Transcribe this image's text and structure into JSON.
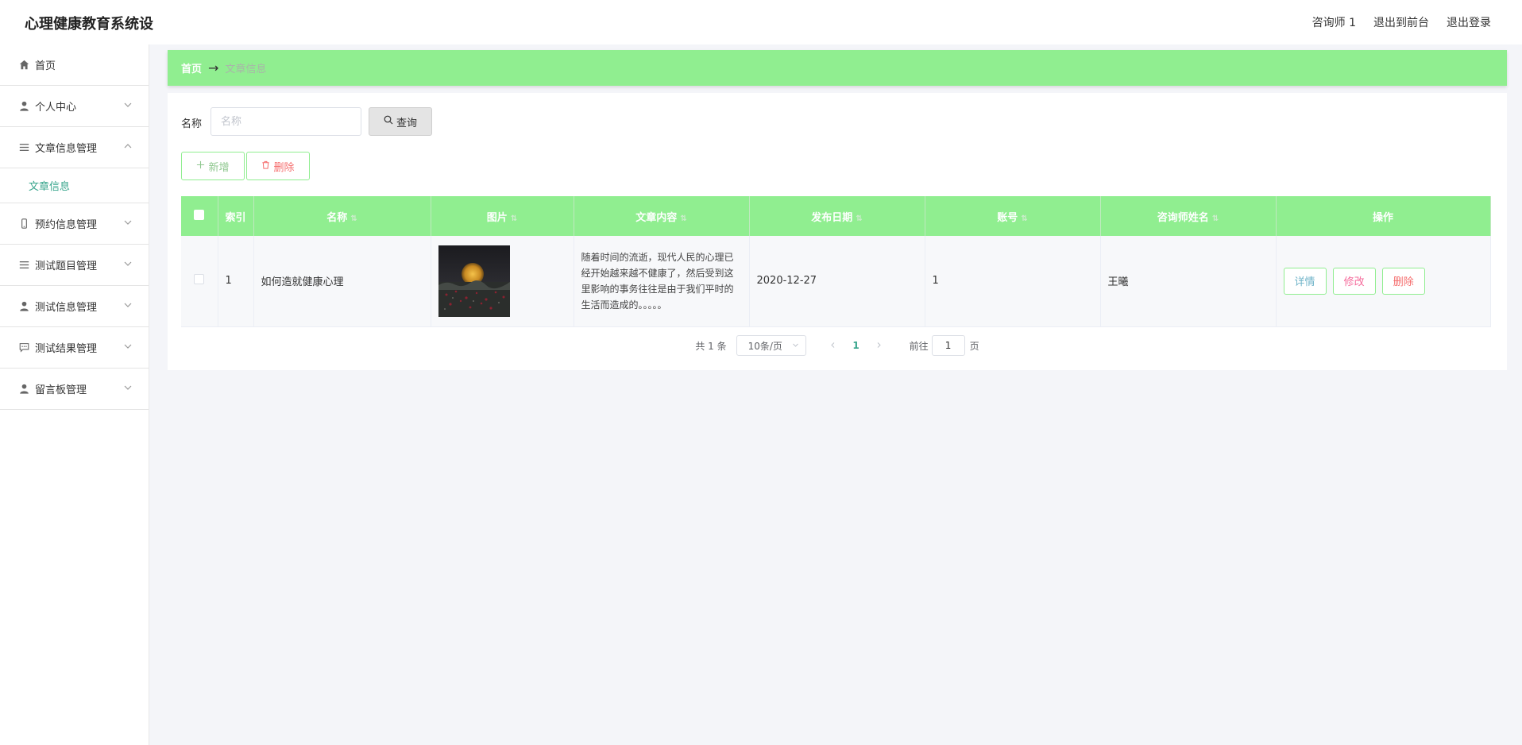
{
  "header": {
    "brand": "心理健康教育系统设",
    "user_label": "咨询师 1",
    "to_front": "退出到前台",
    "logout": "退出登录"
  },
  "sidebar": {
    "items": [
      {
        "label": "首页",
        "icon": "home-icon"
      },
      {
        "label": "个人中心",
        "icon": "user-icon"
      },
      {
        "label": "文章信息管理",
        "icon": "list-icon",
        "expanded": true,
        "sub": [
          {
            "label": "文章信息"
          }
        ]
      },
      {
        "label": "预约信息管理",
        "icon": "phone-icon"
      },
      {
        "label": "测试题目管理",
        "icon": "list-icon"
      },
      {
        "label": "测试信息管理",
        "icon": "user-icon"
      },
      {
        "label": "测试结果管理",
        "icon": "chat-icon"
      },
      {
        "label": "留言板管理",
        "icon": "user-icon"
      }
    ]
  },
  "breadcrumb": {
    "home": "首页",
    "arrow": "→",
    "current": "文章信息"
  },
  "search": {
    "label": "名称",
    "placeholder": "名称",
    "value": "",
    "button": "查询"
  },
  "actions": {
    "add": "新增",
    "delete": "删除"
  },
  "table": {
    "columns": [
      "索引",
      "名称",
      "图片",
      "文章内容",
      "发布日期",
      "账号",
      "咨询师姓名",
      "操作"
    ],
    "rows": [
      {
        "index": "1",
        "name": "如何造就健康心理",
        "content": "随着时间的流逝，现代人民的心理已经开始越来越不健康了，然后受到这里影响的事务往往是由于我们平时的生活而造成的。。。。。",
        "date": "2020-12-27",
        "account": "1",
        "counselor": "王曦",
        "ops": {
          "detail": "详情",
          "edit": "修改",
          "delete": "删除"
        }
      }
    ]
  },
  "pagination": {
    "total": "共 1 条",
    "page_size": "10条/页",
    "current_page": "1",
    "goto_label": "前往",
    "goto_value": "1",
    "page_suffix": "页"
  },
  "colors": {
    "accent_green": "#90ee90",
    "teal": "#37a58c",
    "danger": "#f56c6c"
  }
}
